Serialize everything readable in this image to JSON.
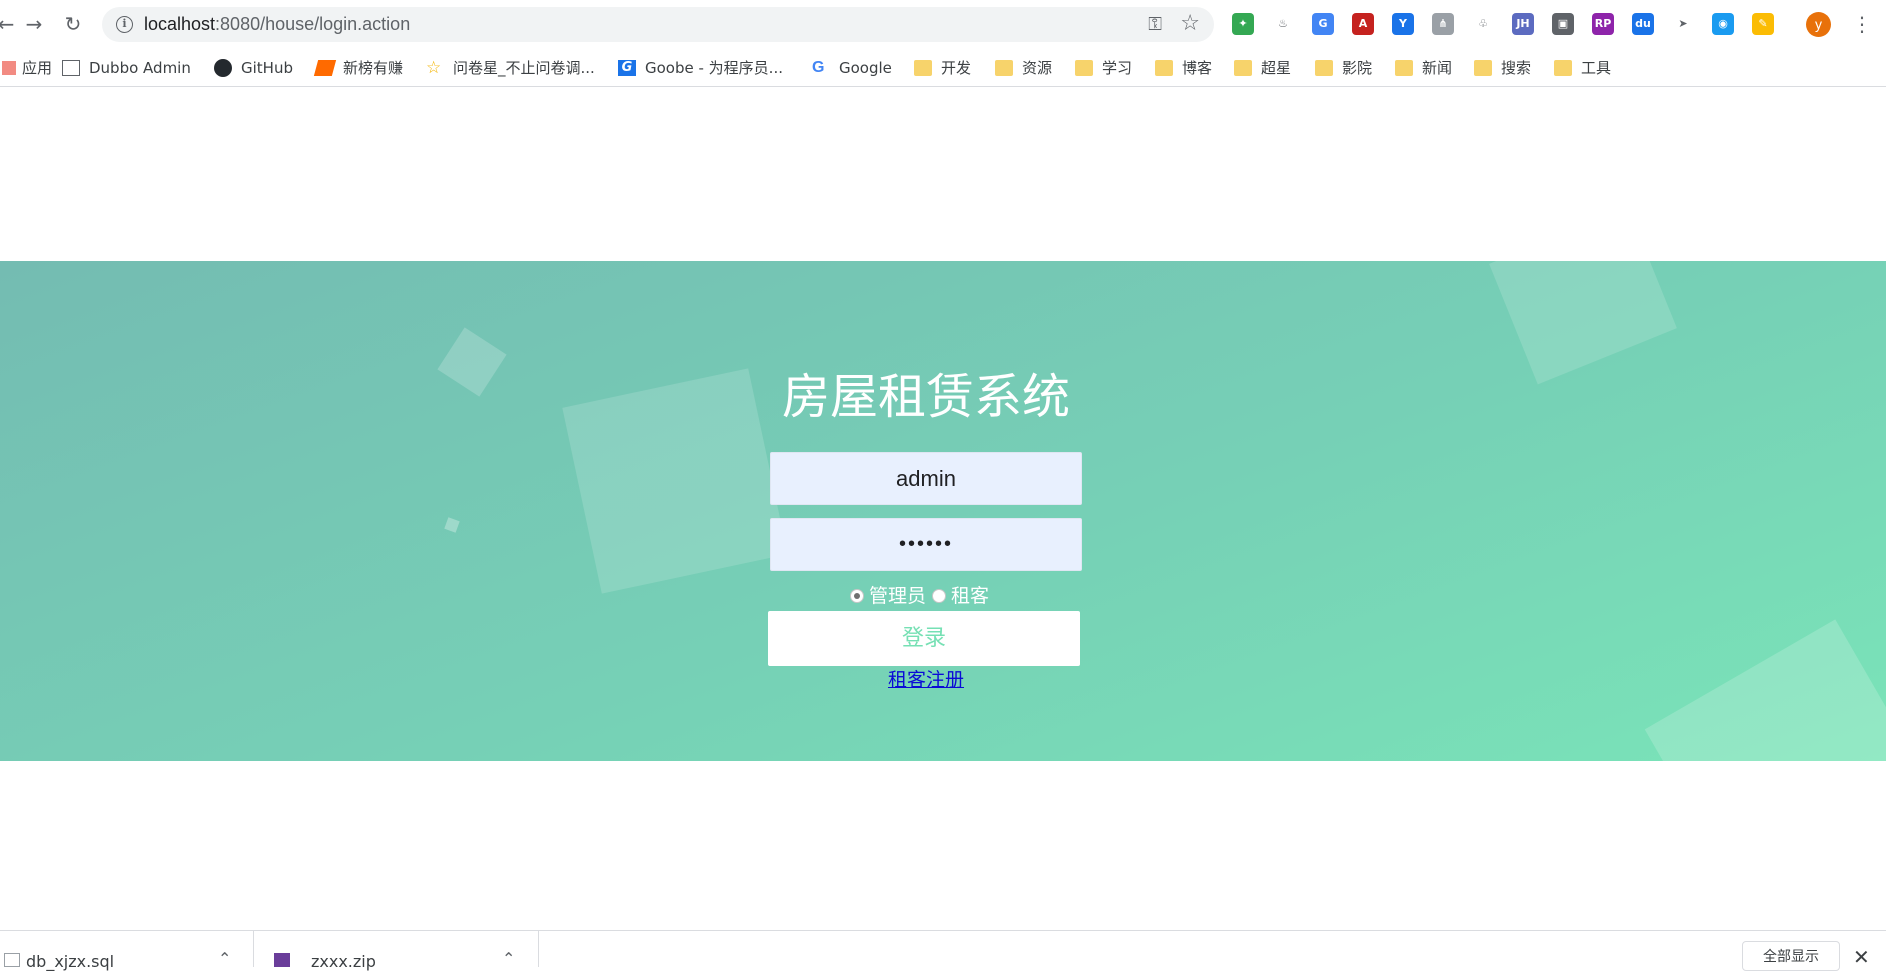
{
  "browser": {
    "url_host": "localhost",
    "url_path": ":8080/house/login.action",
    "avatar_letter": "y",
    "extensions": [
      {
        "name": "ext-green-icon",
        "color": "#34a853",
        "label": "✦"
      },
      {
        "name": "ext-java-icon",
        "color": "#ffffff",
        "label": "♨"
      },
      {
        "name": "ext-translate-icon",
        "color": "#4285f4",
        "label": "G"
      },
      {
        "name": "ext-acrobat-icon",
        "color": "#c5221f",
        "label": "A"
      },
      {
        "name": "ext-y-icon",
        "color": "#1a73e8",
        "label": "Y"
      },
      {
        "name": "ext-tree-icon",
        "color": "#9aa0a6",
        "label": "⋔"
      },
      {
        "name": "ext-leaf-icon",
        "color": "#ffffff",
        "label": "♧"
      },
      {
        "name": "ext-jh-icon",
        "color": "#5c6bc0",
        "label": "JH"
      },
      {
        "name": "ext-screen-icon",
        "color": "#5f6368",
        "label": "▣"
      },
      {
        "name": "ext-rp-icon",
        "color": "#8e24aa",
        "label": "RP"
      },
      {
        "name": "ext-du-icon",
        "color": "#1a73e8",
        "label": "du"
      },
      {
        "name": "ext-cursor-icon",
        "color": "#ffffff",
        "label": "➤"
      },
      {
        "name": "ext-chat-icon",
        "color": "#1a9bf0",
        "label": "◉"
      },
      {
        "name": "ext-color-icon",
        "color": "#fbbc04",
        "label": "✎"
      }
    ]
  },
  "bookmarks": [
    {
      "name": "bookmark-apps",
      "label": "应用",
      "icon": "apps"
    },
    {
      "name": "bookmark-dubbo-admin",
      "label": "Dubbo Admin",
      "icon": "dubbo"
    },
    {
      "name": "bookmark-github",
      "label": "GitHub",
      "icon": "github"
    },
    {
      "name": "bookmark-xinbang",
      "label": "新榜有赚",
      "icon": "xbyz"
    },
    {
      "name": "bookmark-wenjuanxing",
      "label": "问卷星_不止问卷调...",
      "icon": "wjx"
    },
    {
      "name": "bookmark-goobe",
      "label": "Goobe - 为程序员...",
      "icon": "goobe"
    },
    {
      "name": "bookmark-google",
      "label": "Google",
      "icon": "google"
    },
    {
      "name": "bookmark-folder-dev",
      "label": "开发",
      "icon": "folder"
    },
    {
      "name": "bookmark-folder-resources",
      "label": "资源",
      "icon": "folder"
    },
    {
      "name": "bookmark-folder-study",
      "label": "学习",
      "icon": "folder"
    },
    {
      "name": "bookmark-folder-blog",
      "label": "博客",
      "icon": "folder"
    },
    {
      "name": "bookmark-folder-chaoxing",
      "label": "超星",
      "icon": "folder"
    },
    {
      "name": "bookmark-folder-cinema",
      "label": "影院",
      "icon": "folder"
    },
    {
      "name": "bookmark-folder-news",
      "label": "新闻",
      "icon": "folder"
    },
    {
      "name": "bookmark-folder-search",
      "label": "搜索",
      "icon": "folder"
    },
    {
      "name": "bookmark-folder-tools",
      "label": "工具",
      "icon": "folder"
    }
  ],
  "login": {
    "title": "房屋租赁系统",
    "username_value": "admin",
    "password_value": "••••••",
    "role_admin_label": "管理员",
    "role_tenant_label": "租客",
    "submit_label": "登录",
    "register_label": "租客注册"
  },
  "downloads": {
    "items": [
      {
        "filename": "db_xjzx.sql"
      },
      {
        "filename": "zxxx.zip"
      }
    ],
    "show_all_label": "全部显示"
  }
}
